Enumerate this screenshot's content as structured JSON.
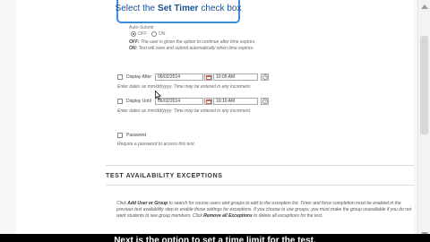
{
  "callout": {
    "text_pre": "Select the",
    "text_bold": "Set Timer",
    "text_post": "check box"
  },
  "auto_submit": {
    "label": "Auto-Submit",
    "off_label": "OFF",
    "on_label": "ON",
    "selected": "OFF",
    "off_note_key": "OFF:",
    "off_note": "The user is given the option to continue after time expires.",
    "on_note_key": "ON:",
    "on_note": "Test will save and submit automatically when time expires."
  },
  "display_after": {
    "label": "Display After",
    "date": "06/02/2014",
    "time": "10:05 AM",
    "note": "Enter dates as mm/dd/yyyy. Time may be entered in any increment."
  },
  "display_until": {
    "label": "Display Until",
    "date": "06/02/2014",
    "time": "10:10 AM",
    "note": "Enter dates as mm/dd/yyyy. Time may be entered in any increment."
  },
  "password": {
    "label": "Password",
    "note": "Require a password to access this test."
  },
  "exceptions": {
    "title": "TEST AVAILABILITY EXCEPTIONS",
    "p1": "Click",
    "b1": "Add User or Group",
    "p2": "to search for course users and groups to add to the exception list. Timer and force completion must be enabled in the previous test availability step to enable those settings for exceptions. If you choose to use groups, you must make the group unavailable if you do not want students to see group members. Click",
    "b2": "Remove all Exceptions",
    "p3": "to delete all exceptions for the test."
  },
  "caption": "Next is the option to set a time limit for the test."
}
